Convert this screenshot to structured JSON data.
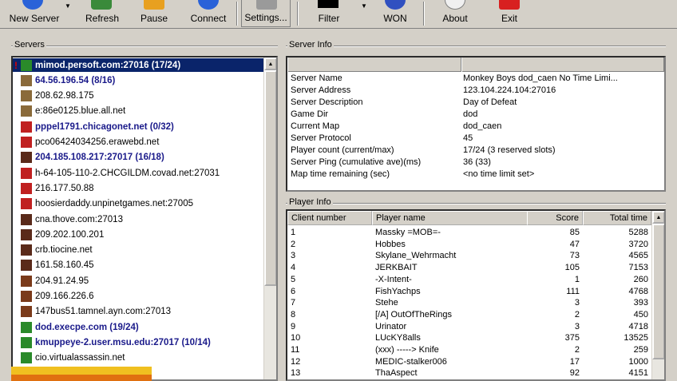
{
  "toolbar": {
    "new_server": "New Server",
    "refresh": "Refresh",
    "pause": "Pause",
    "connect": "Connect",
    "settings": "Settings",
    "filter": "Filter",
    "won": "WON",
    "about": "About",
    "exit": "Exit"
  },
  "servers": {
    "label": "Servers",
    "items": [
      {
        "name": "mimod.persoft.com:27016 (17/24)",
        "bold": true,
        "selected": true,
        "alert": true,
        "icon": "dod-icon"
      },
      {
        "name": "64.56.196.54 (8/16)",
        "bold": true,
        "selected": false,
        "alert": false,
        "icon": "soldier-icon"
      },
      {
        "name": "208.62.98.175",
        "bold": false,
        "selected": false,
        "alert": false,
        "icon": "soldier-icon"
      },
      {
        "name": "e:86e0125.blue.all.net",
        "bold": false,
        "selected": false,
        "alert": false,
        "icon": "soldier-icon"
      },
      {
        "name": "pppel1791.chicagonet.net (0/32)",
        "bold": true,
        "selected": false,
        "alert": false,
        "icon": "tfc-icon"
      },
      {
        "name": "pco06424034256.erawebd.net",
        "bold": false,
        "selected": false,
        "alert": false,
        "icon": "tfc-icon"
      },
      {
        "name": "204.185.108.217:27017 (16/18)",
        "bold": true,
        "selected": false,
        "alert": false,
        "icon": "hl-icon"
      },
      {
        "name": "h-64-105-110-2.CHCGILDM.covad.net:27031",
        "bold": false,
        "selected": false,
        "alert": false,
        "icon": "tfc-icon"
      },
      {
        "name": "216.177.50.88",
        "bold": false,
        "selected": false,
        "alert": false,
        "icon": "tfc-icon"
      },
      {
        "name": "hoosierdaddy.unpinetgames.net:27005",
        "bold": false,
        "selected": false,
        "alert": false,
        "icon": "tfc-icon"
      },
      {
        "name": "cna.thove.com:27013",
        "bold": false,
        "selected": false,
        "alert": false,
        "icon": "hl-icon"
      },
      {
        "name": "209.202.100.201",
        "bold": false,
        "selected": false,
        "alert": false,
        "icon": "hl-icon"
      },
      {
        "name": "crb.tiocine.net",
        "bold": false,
        "selected": false,
        "alert": false,
        "icon": "hl-icon"
      },
      {
        "name": "161.58.160.45",
        "bold": false,
        "selected": false,
        "alert": false,
        "icon": "hl-icon"
      },
      {
        "name": "204.91.24.95",
        "bold": false,
        "selected": false,
        "alert": false,
        "icon": "lambda-icon"
      },
      {
        "name": "209.166.226.6",
        "bold": false,
        "selected": false,
        "alert": false,
        "icon": "lambda-icon"
      },
      {
        "name": "147bus51.tamnel.ayn.com:27013",
        "bold": false,
        "selected": false,
        "alert": false,
        "icon": "lambda-icon"
      },
      {
        "name": "dod.execpe.com (19/24)",
        "bold": true,
        "selected": false,
        "alert": false,
        "icon": "dod-icon"
      },
      {
        "name": "kmuppeye-2.user.msu.edu:27017 (10/14)",
        "bold": true,
        "selected": false,
        "alert": false,
        "icon": "dod-icon"
      },
      {
        "name": "cio.virtualassassin.net",
        "bold": false,
        "selected": false,
        "alert": false,
        "icon": "dod-icon"
      }
    ]
  },
  "server_info": {
    "label": "Server Info",
    "rows": [
      {
        "k": "Server Name",
        "v": "Monkey Boys dod_caen No Time Limi..."
      },
      {
        "k": "Server Address",
        "v": "123.104.224.104:27016"
      },
      {
        "k": "Server Description",
        "v": "Day of Defeat"
      },
      {
        "k": "Game Dir",
        "v": "dod"
      },
      {
        "k": "Current Map",
        "v": "dod_caen"
      },
      {
        "k": "Server Protocol",
        "v": "45"
      },
      {
        "k": "Player count (current/max)",
        "v": "17/24 (3 reserved slots)"
      },
      {
        "k": "Server Ping (cumulative ave)(ms)",
        "v": "36 (33)"
      },
      {
        "k": "Map time remaining (sec)",
        "v": "<no time limit set>"
      }
    ]
  },
  "player_info": {
    "label": "Player Info",
    "headers": {
      "client": "Client number",
      "name": "Player name",
      "score": "Score",
      "time": "Total time"
    },
    "rows": [
      {
        "n": "1",
        "name": "Massky =MOB=-",
        "score": "85",
        "time": "5288"
      },
      {
        "n": "2",
        "name": "Hobbes",
        "score": "47",
        "time": "3720"
      },
      {
        "n": "3",
        "name": "Skylane_Wehrmacht",
        "score": "73",
        "time": "4565"
      },
      {
        "n": "4",
        "name": "JERKBAIT",
        "score": "105",
        "time": "7153"
      },
      {
        "n": "5",
        "name": "-X-Intent-",
        "score": "1",
        "time": "260"
      },
      {
        "n": "6",
        "name": "FishYachps",
        "score": "111",
        "time": "4768"
      },
      {
        "n": "7",
        "name": "Stehe",
        "score": "3",
        "time": "393"
      },
      {
        "n": "8",
        "name": "[/A] OutOfTheRings",
        "score": "2",
        "time": "450"
      },
      {
        "n": "9",
        "name": "Urinator",
        "score": "3",
        "time": "4718"
      },
      {
        "n": "10",
        "name": "LUcKY8alls",
        "score": "375",
        "time": "13525"
      },
      {
        "n": "11",
        "name": "(xxx) -----> Knife",
        "score": "2",
        "time": "259"
      },
      {
        "n": "12",
        "name": "MEDIC-stalker006",
        "score": "17",
        "time": "1000"
      },
      {
        "n": "13",
        "name": "ThaAspect",
        "score": "92",
        "time": "4151"
      }
    ]
  },
  "colors": {
    "selection": "#0a246a",
    "bold_server": "#1a1a8a",
    "ping_green": "#008000"
  }
}
